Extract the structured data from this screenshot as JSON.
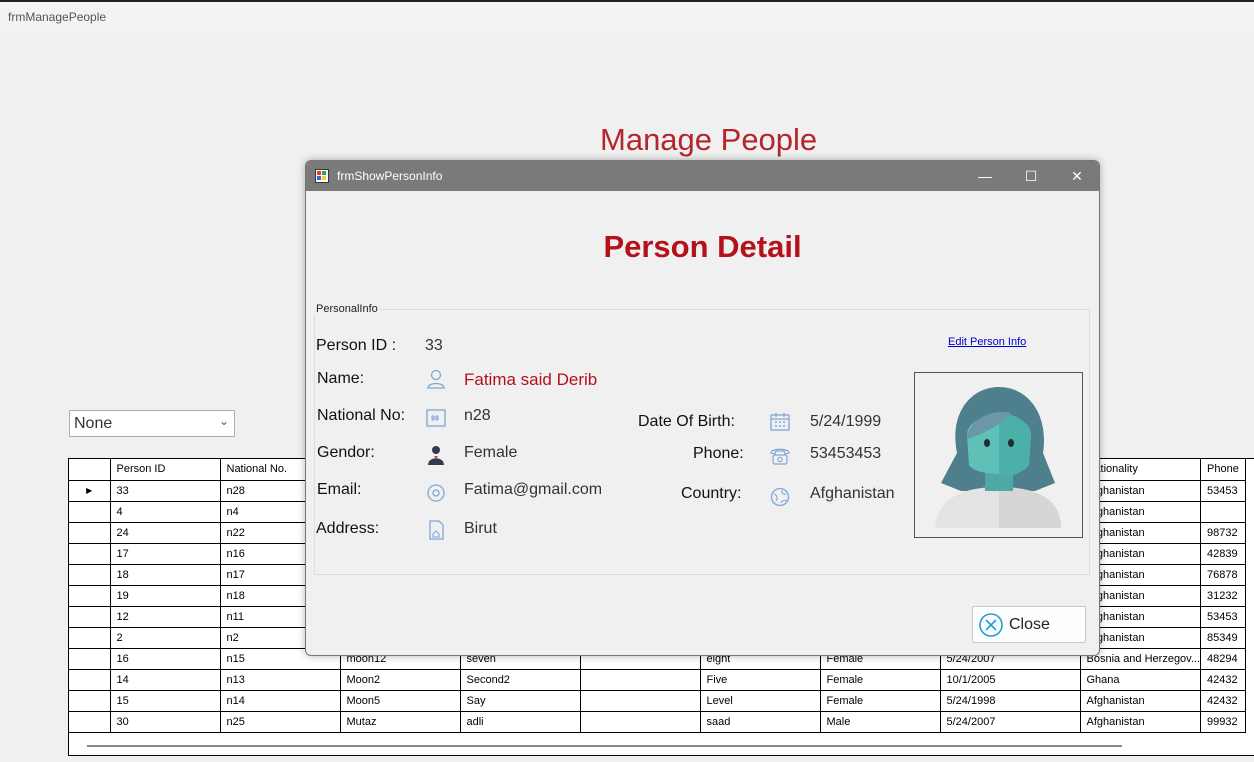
{
  "main_window": {
    "title": "frmManagePeople"
  },
  "page_title": "Manage People",
  "filter": {
    "selected": "None"
  },
  "grid": {
    "columns": [
      "Person ID",
      "National No.",
      "Nationality",
      "Phone"
    ],
    "visible_rows": [
      [
        "33",
        "n28",
        "",
        "",
        "",
        "",
        "",
        "",
        "Afghanistan",
        "53453"
      ],
      [
        "4",
        "n4",
        "",
        "",
        "",
        "",
        "",
        "",
        "Afghanistan",
        ""
      ],
      [
        "24",
        "n22",
        "",
        "",
        "",
        "",
        "",
        "",
        "Afghanistan",
        "98732"
      ],
      [
        "17",
        "n16",
        "",
        "",
        "",
        "",
        "",
        "",
        "Afghanistan",
        "42839"
      ],
      [
        "18",
        "n17",
        "",
        "",
        "",
        "",
        "",
        "",
        "Afghanistan",
        "76878"
      ],
      [
        "19",
        "n18",
        "",
        "",
        "",
        "",
        "",
        "",
        "Afghanistan",
        "31232"
      ],
      [
        "12",
        "n11",
        "",
        "",
        "",
        "",
        "",
        "",
        "Afghanistan",
        "53453"
      ],
      [
        "2",
        "n2",
        "",
        "",
        "",
        "",
        "",
        "",
        "Afghanistan",
        "85349"
      ],
      [
        "16",
        "n15",
        "moon12",
        "seven",
        "",
        "eight",
        "Female",
        "5/24/2007",
        "Bosnia and Herzegov...",
        "48294"
      ],
      [
        "14",
        "n13",
        "Moon2",
        "Second2",
        "",
        "Five",
        "Female",
        "10/1/2005",
        "Ghana",
        "42432"
      ],
      [
        "15",
        "n14",
        "Moon5",
        "Say",
        "",
        "Level",
        "Female",
        "5/24/1998",
        "Afghanistan",
        "42432"
      ],
      [
        "30",
        "n25",
        "Mutaz",
        "adli",
        "",
        "saad",
        "Male",
        "5/24/2007",
        "Afghanistan",
        "99932"
      ]
    ]
  },
  "dialog": {
    "title": "frmShowPersonInfo",
    "heading": "Person Detail",
    "group_label": "PersonalInfo",
    "edit_link": "Edit Person Info",
    "close_label": "Close",
    "labels": {
      "person_id": "Person ID :",
      "name": "Name:",
      "national_no": "National No:",
      "gender": "Gendor:",
      "email": "Email:",
      "address": "Address:",
      "dob": "Date Of Birth:",
      "phone": "Phone:",
      "country": "Country:"
    },
    "values": {
      "person_id": "33",
      "name": "Fatima said  Derib",
      "national_no": "n28",
      "gender": "Female",
      "email": "Fatima@gmail.com",
      "address": "Birut",
      "dob": "5/24/1999",
      "phone": "53453453",
      "country": "Afghanistan"
    }
  },
  "colors": {
    "accent_red": "#b5111b",
    "icon_blue": "#7fa7d6"
  }
}
